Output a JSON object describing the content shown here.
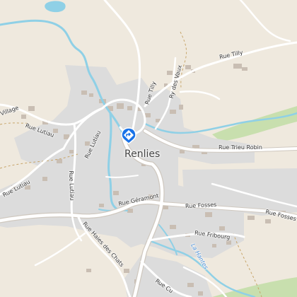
{
  "map": {
    "colors": {
      "background": "#efe9de",
      "residential": "#dcdcdc",
      "building": "#c9beb3",
      "road": "#ffffff",
      "road_casing": "#cfc8bf",
      "water": "#8fd0e6",
      "forest": "#c8dfae",
      "boundary": "#c7a56a",
      "marker": "#1a73e8"
    },
    "town": {
      "name": "Renlies"
    },
    "marker": {
      "icon": "directions-pin-icon"
    },
    "streets": [
      {
        "id": "rue-tilly-ne",
        "label": "Rue Tilly"
      },
      {
        "id": "rue-tilly-n",
        "label": "Rue Tilly"
      },
      {
        "id": "ry-des-vaux",
        "label": "Ry des Vaux"
      },
      {
        "id": "rue-trieu-robin",
        "label": "Rue Trieu Robin"
      },
      {
        "id": "rue-lutiau-nw",
        "label": "Rue Lutiau"
      },
      {
        "id": "rue-lutiau-w",
        "label": "Rue Lutiau"
      },
      {
        "id": "rue-lutiau-s",
        "label": "Rue Lutiau"
      },
      {
        "id": "rue-village",
        "label": "Village"
      },
      {
        "id": "rue-geramont",
        "label": "Rue Géramont"
      },
      {
        "id": "rue-fosses",
        "label": "Rue Fosses"
      },
      {
        "id": "rue-fosses-e",
        "label": "Rue Fosses"
      },
      {
        "id": "rue-haies-des-chats",
        "label": "Rue Haies des Chats"
      },
      {
        "id": "rue-fribourg",
        "label": "Rue Fribourg"
      },
      {
        "id": "rue-cu",
        "label": "Rue Cu"
      },
      {
        "id": "rue-lutiau-nw2",
        "label": "Rue Lutiau"
      }
    ],
    "waterways": [
      {
        "id": "la-hantes",
        "label": "La Hantes"
      }
    ]
  }
}
